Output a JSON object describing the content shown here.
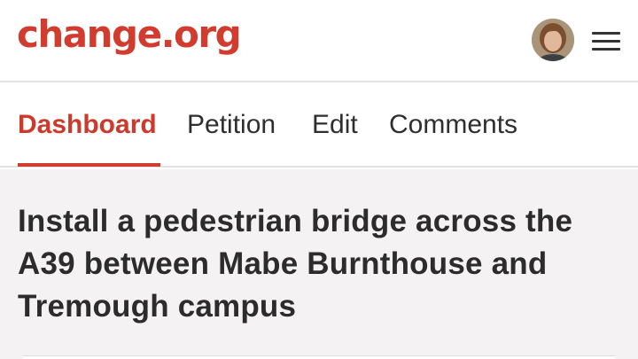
{
  "header": {
    "logo_text": "change.org",
    "brand_color": "#d23c2f",
    "avatar_icon": "user-avatar",
    "menu_icon": "hamburger-menu-icon"
  },
  "tabs": [
    {
      "label": "Dashboard",
      "active": true
    },
    {
      "label": "Petition",
      "active": false
    },
    {
      "label": "Edit",
      "active": false
    },
    {
      "label": "Comments",
      "active": false
    }
  ],
  "petition": {
    "title": "Install a pedestrian bridge across the A39 between Mabe Burnthouse and Tremough campus"
  }
}
